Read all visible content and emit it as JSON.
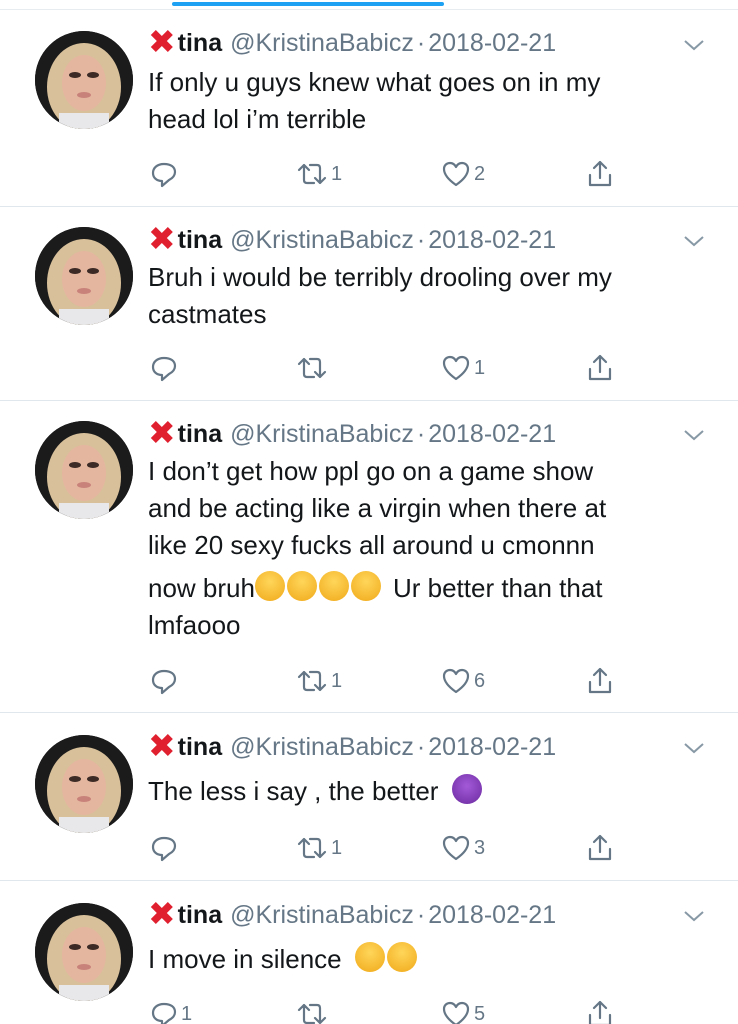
{
  "profile": {
    "x_mark": "✖",
    "name": "tina",
    "handle": "@KristinaBabicz",
    "separator": "·"
  },
  "icons": {
    "reply": "reply-icon",
    "retweet": "retweet-icon",
    "like": "heart-icon",
    "share": "share-icon",
    "menu": "chevron-down-icon"
  },
  "colors": {
    "x_mark": "#e0202f",
    "text": "#14171a",
    "muted": "#657786",
    "accent": "#1da1f2"
  },
  "tweets": [
    {
      "date": "2018-02-21",
      "lines": [
        "If only u guys knew what goes on in my",
        "head lol i’m terrible"
      ],
      "replies": "",
      "retweets": "1",
      "likes": "2"
    },
    {
      "date": "2018-02-21",
      "lines": [
        "Bruh i would be terribly drooling over my",
        "castmates"
      ],
      "replies": "",
      "retweets": "",
      "likes": "1"
    },
    {
      "date": "2018-02-21",
      "lines": [
        "I don’t get how ppl go on a game show",
        "and be acting like a virgin when there at",
        "like 20 sexy fucks all around u cmonnn",
        "now bruh",
        "Ur better than that",
        "lmfaooo"
      ],
      "emoji": [
        "weary-face-emoji",
        "weary-face-emoji",
        "weary-face-emoji",
        "weary-face-emoji"
      ],
      "replies": "",
      "retweets": "1",
      "likes": "6"
    },
    {
      "date": "2018-02-21",
      "lines": [
        "The less i say , the better"
      ],
      "emoji": [
        "smiling-devil-emoji"
      ],
      "replies": "",
      "retweets": "1",
      "likes": "3"
    },
    {
      "date": "2018-02-21",
      "lines": [
        "I move in silence"
      ],
      "emoji": [
        "shushing-face-emoji",
        "shushing-face-emoji"
      ],
      "replies": "1",
      "retweets": "",
      "likes": "5"
    }
  ]
}
